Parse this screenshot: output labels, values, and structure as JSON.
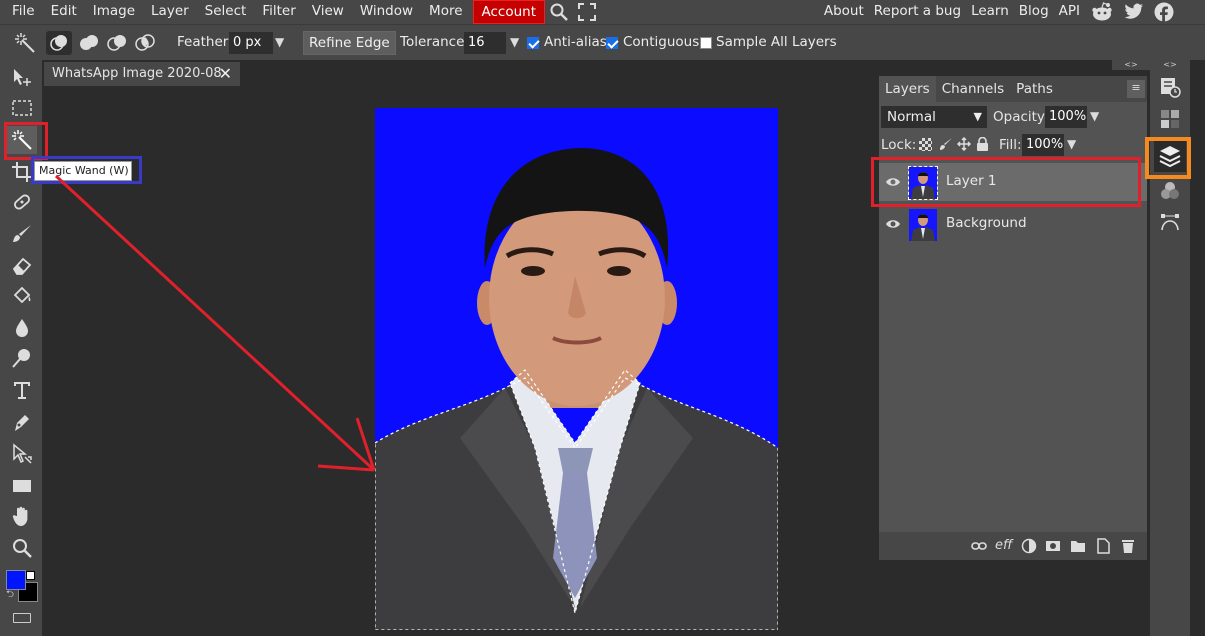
{
  "menubar": {
    "items": [
      "File",
      "Edit",
      "Image",
      "Layer",
      "Select",
      "Filter",
      "View",
      "Window",
      "More"
    ],
    "account_label": "Account",
    "right_items": [
      "About",
      "Report a bug",
      "Learn",
      "Blog",
      "API"
    ]
  },
  "options": {
    "feather_label": "Feather:",
    "feather_value": "0 px",
    "refine_edge_label": "Refine Edge",
    "tolerance_label": "Tolerance:",
    "tolerance_value": "16",
    "antialias_label": "Anti-alias",
    "antialias_checked": true,
    "contiguous_label": "Contiguous",
    "contiguous_checked": true,
    "sample_all_label": "Sample All Layers",
    "sample_all_checked": false
  },
  "document": {
    "tab_title": "WhatsApp Image 2020-08",
    "close_glyph": "✕"
  },
  "tooltip": {
    "text": "Magic Wand (W)"
  },
  "colors": {
    "foreground": "#0015ff",
    "background": "#000000",
    "accent_red": "#e0202a",
    "accent_blue": "#3a3ac8",
    "accent_orange": "#f58a1f"
  },
  "layers_panel": {
    "tabs": [
      "Layers",
      "Channels",
      "Paths"
    ],
    "menu_glyph": "≡",
    "blend_mode": "Normal",
    "opacity_label": "Opacity:",
    "opacity_value": "100%",
    "lock_label": "Lock:",
    "fill_label": "Fill:",
    "fill_value": "100%",
    "layers": [
      {
        "name": "Layer 1",
        "selected": true
      },
      {
        "name": "Background",
        "selected": false
      }
    ]
  },
  "icons": {
    "menubar": [
      "search-icon",
      "fullscreen-icon",
      "reddit-icon",
      "twitter-icon",
      "facebook-icon"
    ],
    "tools": [
      "move-icon",
      "marquee-icon",
      "magic-wand-icon",
      "crop-icon",
      "healing-icon",
      "brush-icon",
      "eraser-icon",
      "paint-bucket-icon",
      "blur-icon",
      "dodge-icon",
      "text-icon",
      "pen-icon",
      "path-select-icon",
      "shape-icon",
      "hand-icon",
      "zoom-icon"
    ],
    "panel_footer": [
      "link-icon",
      "effects-icon",
      "adjustment-icon",
      "mask-icon",
      "folder-icon",
      "new-layer-icon",
      "trash-icon"
    ],
    "right_strip": [
      "history-icon",
      "swatches-icon",
      "layers-icon",
      "channels-icon",
      "paths-icon"
    ]
  }
}
